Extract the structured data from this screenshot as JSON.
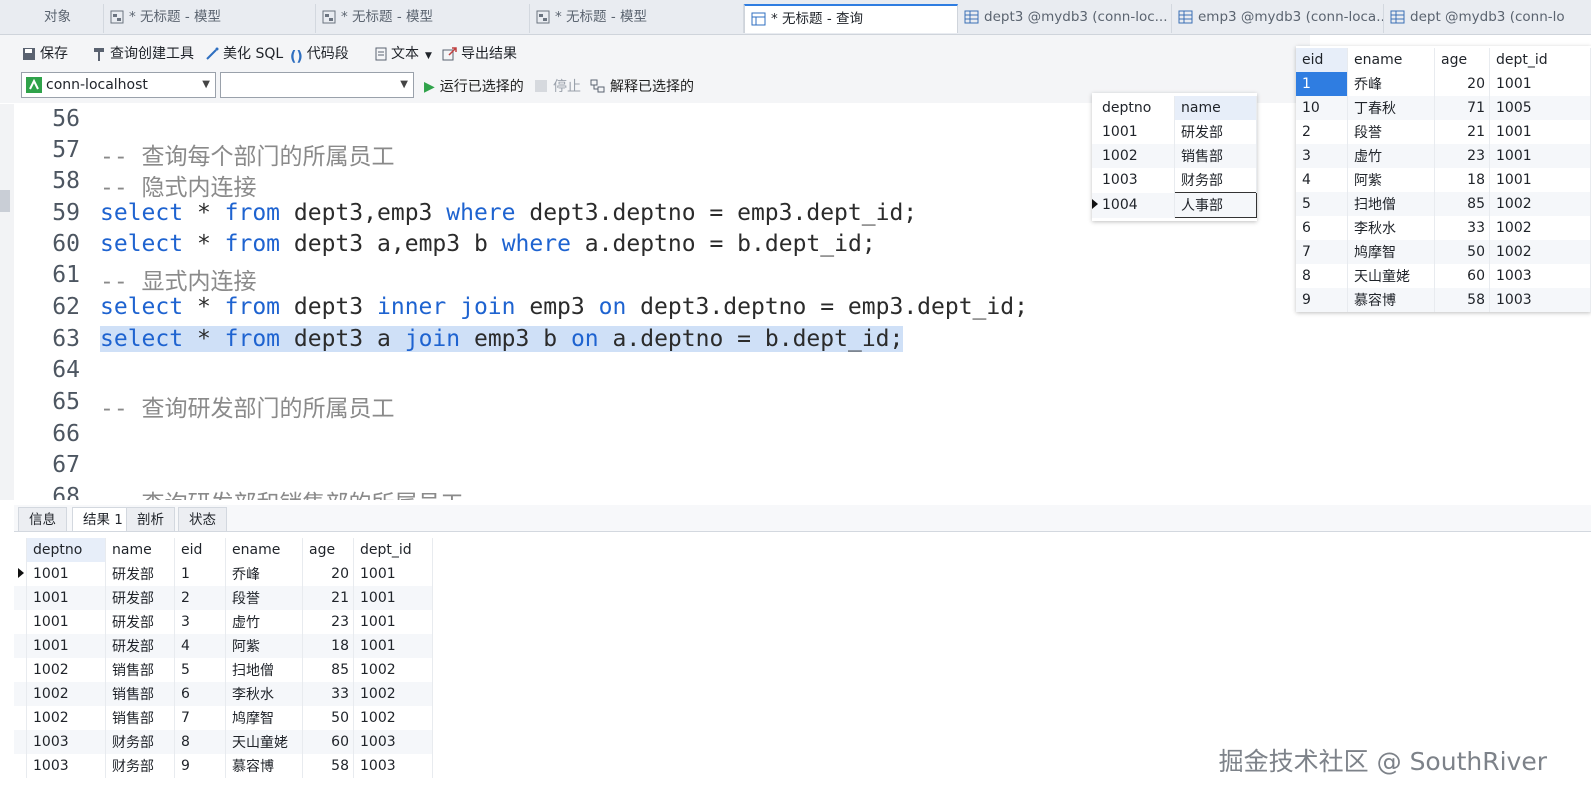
{
  "tabs": [
    {
      "label": "对象"
    },
    {
      "label": "* 无标题 - 模型"
    },
    {
      "label": "* 无标题 - 模型"
    },
    {
      "label": "* 无标题 - 模型"
    },
    {
      "label": "* 无标题 - 查询"
    },
    {
      "label": "dept3 @mydb3 (conn-loc..."
    },
    {
      "label": "emp3 @mydb3 (conn-loca..."
    },
    {
      "label": "dept @mydb3 (conn-lo"
    }
  ],
  "toolbar": {
    "save": "保存",
    "query_builder": "查询创建工具",
    "beautify": "美化 SQL",
    "snippet": "代码段",
    "text": "文本",
    "export": "导出结果"
  },
  "run_bar": {
    "connection": "conn-localhost",
    "database": "",
    "run_selected": "运行已选择的",
    "stop": "停止",
    "explain": "解释已选择的"
  },
  "editor": {
    "lines": [
      {
        "no": "56",
        "code": ""
      },
      {
        "no": "57",
        "code": "-- 查询每个部门的所属员工"
      },
      {
        "no": "58",
        "code": "-- 隐式内连接"
      },
      {
        "no": "59",
        "code": "select * from dept3,emp3 where dept3.deptno = emp3.dept_id;"
      },
      {
        "no": "60",
        "code": "select * from dept3 a,emp3 b where a.deptno = b.dept_id;"
      },
      {
        "no": "61",
        "code": "-- 显式内连接"
      },
      {
        "no": "62",
        "code": "select * from dept3 inner join emp3 on dept3.deptno = emp3.dept_id;"
      },
      {
        "no": "63",
        "code": "select * from dept3 a join emp3 b on a.deptno = b.dept_id;"
      },
      {
        "no": "64",
        "code": ""
      },
      {
        "no": "65",
        "code": "-- 查询研发部门的所属员工"
      },
      {
        "no": "66",
        "code": ""
      },
      {
        "no": "67",
        "code": ""
      },
      {
        "no": "68",
        "code": "-- 查询研发部和销售部的所属员工"
      }
    ]
  },
  "dept_popup": {
    "headers": [
      "deptno",
      "name"
    ],
    "rows": [
      [
        "1001",
        "研发部"
      ],
      [
        "1002",
        "销售部"
      ],
      [
        "1003",
        "财务部"
      ],
      [
        "1004",
        "人事部"
      ]
    ]
  },
  "emp_popup": {
    "headers": [
      "eid",
      "ename",
      "age",
      "dept_id"
    ],
    "rows": [
      [
        "1",
        "乔峰",
        "20",
        "1001"
      ],
      [
        "10",
        "丁春秋",
        "71",
        "1005"
      ],
      [
        "2",
        "段誉",
        "21",
        "1001"
      ],
      [
        "3",
        "虚竹",
        "23",
        "1001"
      ],
      [
        "4",
        "阿紫",
        "18",
        "1001"
      ],
      [
        "5",
        "扫地僧",
        "85",
        "1002"
      ],
      [
        "6",
        "李秋水",
        "33",
        "1002"
      ],
      [
        "7",
        "鸠摩智",
        "50",
        "1002"
      ],
      [
        "8",
        "天山童姥",
        "60",
        "1003"
      ],
      [
        "9",
        "慕容博",
        "58",
        "1003"
      ]
    ]
  },
  "result_tabs": [
    "信息",
    "结果 1",
    "剖析",
    "状态"
  ],
  "results": {
    "headers": [
      "deptno",
      "name",
      "eid",
      "ename",
      "age",
      "dept_id"
    ],
    "rows": [
      [
        "1001",
        "研发部",
        "1",
        "乔峰",
        "20",
        "1001"
      ],
      [
        "1001",
        "研发部",
        "2",
        "段誉",
        "21",
        "1001"
      ],
      [
        "1001",
        "研发部",
        "3",
        "虚竹",
        "23",
        "1001"
      ],
      [
        "1001",
        "研发部",
        "4",
        "阿紫",
        "18",
        "1001"
      ],
      [
        "1002",
        "销售部",
        "5",
        "扫地僧",
        "85",
        "1002"
      ],
      [
        "1002",
        "销售部",
        "6",
        "李秋水",
        "33",
        "1002"
      ],
      [
        "1002",
        "销售部",
        "7",
        "鸠摩智",
        "50",
        "1002"
      ],
      [
        "1003",
        "财务部",
        "8",
        "天山童姥",
        "60",
        "1003"
      ],
      [
        "1003",
        "财务部",
        "9",
        "慕容博",
        "58",
        "1003"
      ]
    ]
  },
  "watermark": "掘金技术社区 @ SouthRiver",
  "colors": {
    "keyword": "#1e63d0",
    "comment": "#8a8a8a",
    "selection": "#cfe0f7",
    "accent": "#2f7de1"
  }
}
